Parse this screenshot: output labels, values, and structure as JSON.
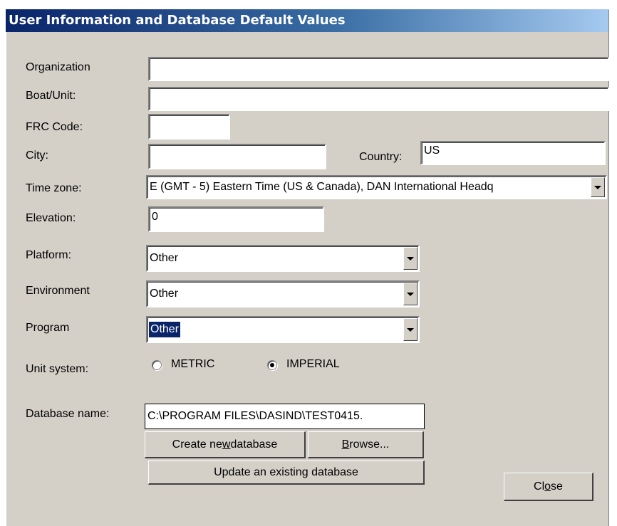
{
  "window": {
    "title": "User Information and Database Default Values"
  },
  "fields": {
    "organization": {
      "label": "Organization",
      "value": ""
    },
    "boat_unit": {
      "label": "Boat/Unit:",
      "value": ""
    },
    "frc_code": {
      "label": "FRC Code:",
      "value": ""
    },
    "city": {
      "label": "City:",
      "value": ""
    },
    "country": {
      "label": "Country:",
      "value": "US"
    },
    "time_zone": {
      "label": "Time zone:",
      "value": "E (GMT - 5)  Eastern Time (US & Canada), DAN International Headq"
    },
    "elevation": {
      "label": "Elevation:",
      "value": "0"
    },
    "platform": {
      "label": "Platform:",
      "value": "Other"
    },
    "environment": {
      "label": "Environment",
      "value": "Other"
    },
    "program": {
      "label": "Program",
      "value": "Other"
    }
  },
  "unit_system": {
    "label": "Unit system:",
    "options": [
      "METRIC",
      "IMPERIAL"
    ],
    "selected": "IMPERIAL"
  },
  "database": {
    "label": "Database name:",
    "value": "C:\\PROGRAM FILES\\DASIND\\TEST0415.",
    "create_button_pre": "Create ne",
    "create_button_mn": "w",
    "create_button_post": " database",
    "browse_button_mn": "B",
    "browse_button_post": "rowse...",
    "update_button": "Update an existing database"
  },
  "close_button": {
    "pre": "Cl",
    "mn": "o",
    "post": "se"
  }
}
